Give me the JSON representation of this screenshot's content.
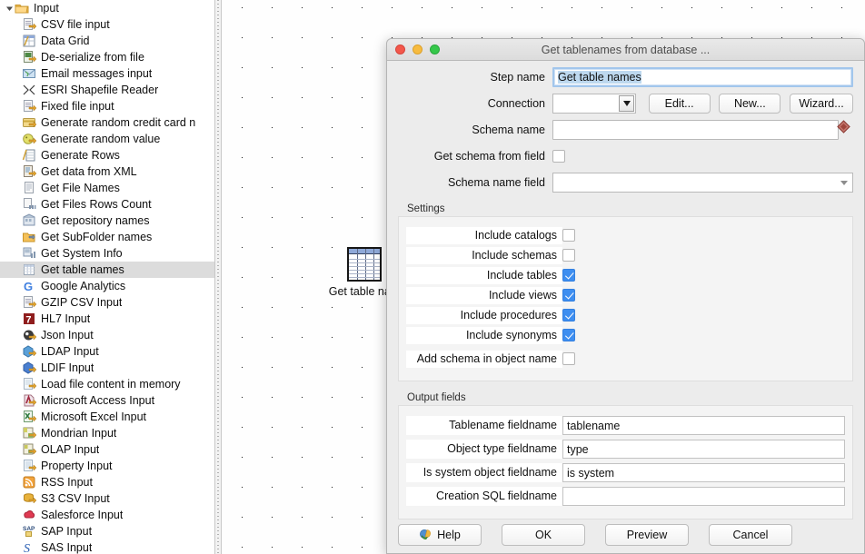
{
  "sidebar": {
    "root": {
      "label": "Input",
      "icon": "folder-open-icon",
      "expanded": true
    },
    "items": [
      {
        "label": "CSV file input",
        "icon": "csv-file-input-icon"
      },
      {
        "label": "Data Grid",
        "icon": "data-grid-icon"
      },
      {
        "label": "De-serialize from file",
        "icon": "deserialize-from-file-icon"
      },
      {
        "label": "Email messages input",
        "icon": "email-messages-input-icon"
      },
      {
        "label": "ESRI Shapefile Reader",
        "icon": "esri-shapefile-reader-icon"
      },
      {
        "label": "Fixed file input",
        "icon": "fixed-file-input-icon"
      },
      {
        "label": "Generate random credit card n",
        "icon": "generate-random-credit-card-icon"
      },
      {
        "label": "Generate random value",
        "icon": "generate-random-value-icon"
      },
      {
        "label": "Generate Rows",
        "icon": "generate-rows-icon"
      },
      {
        "label": "Get data from XML",
        "icon": "get-data-from-xml-icon"
      },
      {
        "label": "Get File Names",
        "icon": "get-file-names-icon"
      },
      {
        "label": "Get Files Rows Count",
        "icon": "get-files-rows-count-icon"
      },
      {
        "label": "Get repository names",
        "icon": "get-repository-names-icon"
      },
      {
        "label": "Get SubFolder names",
        "icon": "get-subfolder-names-icon"
      },
      {
        "label": "Get System Info",
        "icon": "get-system-info-icon"
      },
      {
        "label": "Get table names",
        "icon": "get-table-names-icon",
        "selected": true
      },
      {
        "label": "Google Analytics",
        "icon": "google-analytics-icon"
      },
      {
        "label": "GZIP CSV Input",
        "icon": "gzip-csv-input-icon"
      },
      {
        "label": "HL7 Input",
        "icon": "hl7-input-icon"
      },
      {
        "label": "Json Input",
        "icon": "json-input-icon"
      },
      {
        "label": "LDAP Input",
        "icon": "ldap-input-icon"
      },
      {
        "label": "LDIF Input",
        "icon": "ldif-input-icon"
      },
      {
        "label": "Load file content in memory",
        "icon": "load-file-content-in-memory-icon"
      },
      {
        "label": "Microsoft Access Input",
        "icon": "microsoft-access-input-icon"
      },
      {
        "label": "Microsoft Excel Input",
        "icon": "microsoft-excel-input-icon"
      },
      {
        "label": "Mondrian Input",
        "icon": "mondrian-input-icon"
      },
      {
        "label": "OLAP Input",
        "icon": "olap-input-icon"
      },
      {
        "label": "Property Input",
        "icon": "property-input-icon"
      },
      {
        "label": "RSS Input",
        "icon": "rss-input-icon"
      },
      {
        "label": "S3 CSV Input",
        "icon": "s3-csv-input-icon"
      },
      {
        "label": "Salesforce Input",
        "icon": "salesforce-input-icon"
      },
      {
        "label": "SAP Input",
        "icon": "sap-input-icon"
      },
      {
        "label": "SAS Input",
        "icon": "sas-input-icon"
      }
    ]
  },
  "canvas": {
    "step": {
      "label": "Get table nam",
      "icon": "table-step-icon"
    }
  },
  "dialog": {
    "title": "Get tablenames from database ...",
    "window_controls": {
      "close": "close-button",
      "minimize": "minimize-button",
      "zoom": "zoom-button"
    },
    "step_name": {
      "label": "Step name",
      "value": "Get table names"
    },
    "connection": {
      "label": "Connection",
      "value": "",
      "edit_label": "Edit...",
      "new_label": "New...",
      "wizard_label": "Wizard..."
    },
    "schema_name": {
      "label": "Schema name",
      "value": ""
    },
    "get_schema_from_field": {
      "label": "Get schema from field",
      "checked": false
    },
    "schema_name_field": {
      "label": "Schema name field",
      "value": ""
    },
    "settings": {
      "title": "Settings",
      "rows": [
        {
          "label": "Include catalogs",
          "checked": false
        },
        {
          "label": "Include schemas",
          "checked": false
        },
        {
          "label": "Include tables",
          "checked": true
        },
        {
          "label": "Include views",
          "checked": true
        },
        {
          "label": "Include procedures",
          "checked": true
        },
        {
          "label": "Include synonyms",
          "checked": true
        }
      ],
      "extra_row": {
        "label": "Add schema in object name",
        "checked": false
      }
    },
    "output_fields": {
      "title": "Output fields",
      "rows": [
        {
          "label": "Tablename fieldname",
          "value": "tablename"
        },
        {
          "label": "Object type fieldname",
          "value": "type"
        },
        {
          "label": "Is system object fieldname",
          "value": "is system"
        },
        {
          "label": "Creation SQL fieldname",
          "value": ""
        }
      ]
    },
    "footer": {
      "help_label": "Help",
      "ok_label": "OK",
      "preview_label": "Preview",
      "cancel_label": "Cancel"
    }
  },
  "colors": {
    "accent_checkbox": "#3e8ef0",
    "selection_text": "#bdd8ef",
    "sidebar_selected": "#dcdcdc",
    "dialog_bg": "#ececec",
    "marker_diamond": "#b4514a"
  }
}
